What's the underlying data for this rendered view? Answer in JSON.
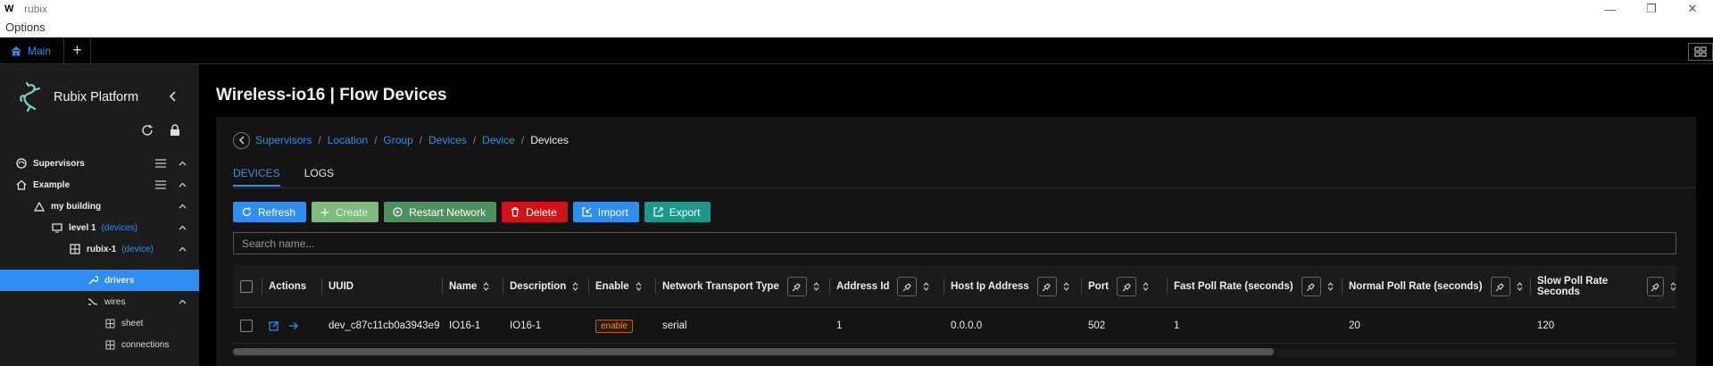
{
  "window": {
    "app_logo": "W",
    "title": "rubix",
    "controls": [
      "—",
      "❐",
      "✕"
    ]
  },
  "menu": {
    "options": "Options"
  },
  "tabs": {
    "main": "Main",
    "add": "+"
  },
  "sidebar": {
    "brand": "Rubix Platform",
    "tree": [
      {
        "label": "Supervisors",
        "tag": ""
      },
      {
        "label": "Example",
        "tag": ""
      },
      {
        "label": "my building",
        "tag": ""
      },
      {
        "label": "level 1",
        "tag": "(devices)"
      },
      {
        "label": "rubix-1",
        "tag": "(device)"
      },
      {
        "label": "drivers",
        "tag": ""
      },
      {
        "label": "wires",
        "tag": ""
      },
      {
        "label": "sheet",
        "tag": ""
      },
      {
        "label": "connections",
        "tag": ""
      }
    ]
  },
  "page": {
    "title": "Wireless-io16 | Flow Devices",
    "breadcrumb": [
      "Supervisors",
      "Location",
      "Group",
      "Devices",
      "Device"
    ],
    "breadcrumb_current": "Devices",
    "tabs": [
      "DEVICES",
      "LOGS"
    ],
    "buttons": {
      "refresh": "Refresh",
      "create": "Create",
      "restart": "Restart Network",
      "delete": "Delete",
      "import": "Import",
      "export": "Export"
    },
    "search_placeholder": "Search name..."
  },
  "table": {
    "columns": [
      "Actions",
      "UUID",
      "Name",
      "Description",
      "Enable",
      "Network Transport Type",
      "Address Id",
      "Host Ip Address",
      "Port",
      "Fast Poll Rate (seconds)",
      "Normal Poll Rate (seconds)",
      "Slow Poll Rate Seconds"
    ],
    "rows": [
      {
        "uuid": "dev_c87c11cb0a3943e9",
        "name": "IO16-1",
        "description": "IO16-1",
        "enable": "enable",
        "transport": "serial",
        "address_id": "1",
        "host_ip": "0.0.0.0",
        "port": "502",
        "fast_poll": "1",
        "normal_poll": "20",
        "slow_poll": "120"
      }
    ]
  },
  "colors": {
    "accent": "#2f8ef1",
    "delete": "#d0131a",
    "export": "#169a8c",
    "restart": "#4d8f5f",
    "enable_badge": "#f08c24"
  }
}
